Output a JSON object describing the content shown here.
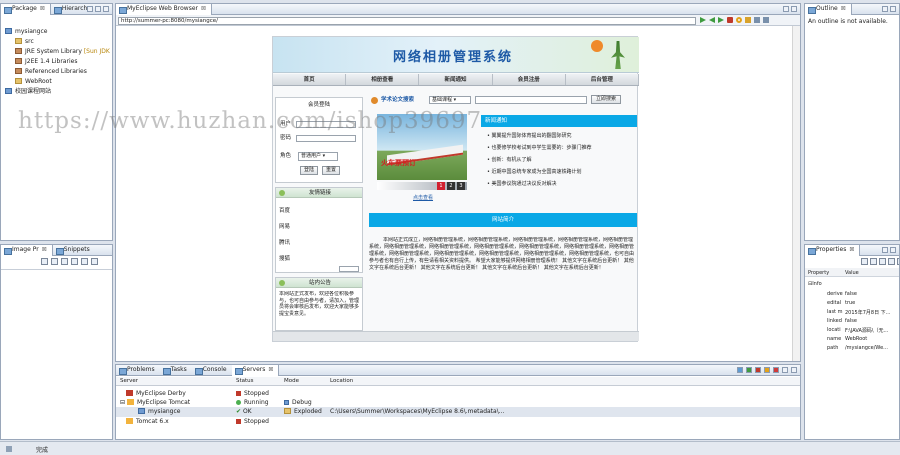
{
  "package_pane": {
    "tabs": [
      "Package",
      "Hierarch"
    ],
    "tree": [
      {
        "label": "mysiangce",
        "indent": 0
      },
      {
        "label": "src",
        "indent": 1
      },
      {
        "label": "JRE System Library",
        "suffix": "[Sun JDK",
        "indent": 1
      },
      {
        "label": "J2EE 1.4 Libraries",
        "indent": 1
      },
      {
        "label": "Referenced Libraries",
        "indent": 1
      },
      {
        "label": "WebRoot",
        "indent": 1
      },
      {
        "label": "校园课程网站",
        "indent": 0
      }
    ]
  },
  "image_pane": {
    "tabs": [
      "Image Pr",
      "Snippets"
    ]
  },
  "browser": {
    "tab": "MyEclipse Web Browser",
    "url": "http://summer-pc:8080/mysiangce/"
  },
  "site": {
    "title": "网络相册管理系统",
    "nav": [
      "首页",
      "相册查看",
      "新闻通知",
      "会员注册",
      "后台管理"
    ],
    "login": {
      "heading": "会员登陆",
      "user_label": "用户",
      "pass_label": "密码",
      "role_label": "角色",
      "role_value": "普通用户",
      "login_btn": "登陆",
      "reset_btn": "重置"
    },
    "links_box": {
      "heading": "友情链接",
      "items": [
        "百度",
        "网易",
        "腾讯",
        "搜狐"
      ]
    },
    "notice_box": {
      "heading": "站内公告",
      "text": "本网站正式发布，欢迎各位积极参与，也可自由参与者，请加入，管理员将会审核后发布，欢迎大家能够多提宝贵意见。"
    },
    "search": {
      "label": "学术论文搜索",
      "select_value": "基础课程",
      "button": "立即搜索"
    },
    "slide": {
      "caption": "火车票预订",
      "pages": [
        "1",
        "2",
        "3"
      ],
      "link": "点击查看"
    },
    "news": {
      "heading": "新闻通知",
      "items": [
        "翼翼提升国际体育提出的翻国际研究",
        "也要修学校考试到中学生需要的：步骤门推荐",
        "创新：有机从了解",
        "近期中国总统专家成为全国高速铁路计划",
        "美国参议院通过决议反对解决"
      ]
    },
    "intro": {
      "heading": "网站简介",
      "text": "本网站正式成立，网络相册管理系统，网络相册管理系统，网络相册管理系统，网络相册管理系统，网络相册管理系统，网络相册管理系统，网络相册管理系统，网络相册管理系统，网络相册管理系统，网络相册管理系统，网络相册管理系统，网络相册管理系统，网络相册管理系统，网络相册管理系统，网络相册管理系统，网络相册管理系统，也可自由参与者也有自行上传，有些请看相关资料提供。 希望大家能够提供网络相册管理系统！ 其他文字在系统后台更新！ 其他文字在系统后台更新！ 其他文字在系统后台更新！ 其他文字在系统后台更新！ 其他文字在系统后台更新！"
    }
  },
  "watermark": "https://www.huzhan.com/ishop39697",
  "outline": {
    "tab": "Outline",
    "message": "An outline is not available."
  },
  "properties": {
    "tab": "Properties",
    "col_property": "Property",
    "col_value": "Value",
    "group": "Info",
    "rows": [
      {
        "k": "derive",
        "v": "false"
      },
      {
        "k": "edital",
        "v": "true"
      },
      {
        "k": "last m",
        "v": "2015年7月8日 下..."
      },
      {
        "k": "linked",
        "v": "false"
      },
      {
        "k": "locati",
        "v": "F:\\JAVA源码\\（无..."
      },
      {
        "k": "name",
        "v": "WebRoot"
      },
      {
        "k": "path",
        "v": "/mysiangce/We..."
      }
    ]
  },
  "bottom": {
    "tabs": [
      "Problems",
      "Tasks",
      "Console",
      "Servers"
    ],
    "columns": [
      "Server",
      "Status",
      "Mode",
      "Location"
    ],
    "rows": [
      {
        "server": "MyEclipse Derby",
        "status": "Stopped",
        "mode": "",
        "location": "",
        "indent": 1
      },
      {
        "server": "MyEclipse Tomcat",
        "status": "Running",
        "mode": "Debug",
        "location": "",
        "indent": 0
      },
      {
        "server": "mysiangce",
        "status": "OK",
        "mode": "Exploded",
        "location": "C:\\Users\\Summer\\Workspaces\\MyEclipse 8.6\\.metadata\\...",
        "indent": 2
      },
      {
        "server": "Tomcat  6.x",
        "status": "Stopped",
        "mode": "",
        "location": "",
        "indent": 0
      }
    ]
  },
  "statusbar": {
    "text": "完成"
  }
}
